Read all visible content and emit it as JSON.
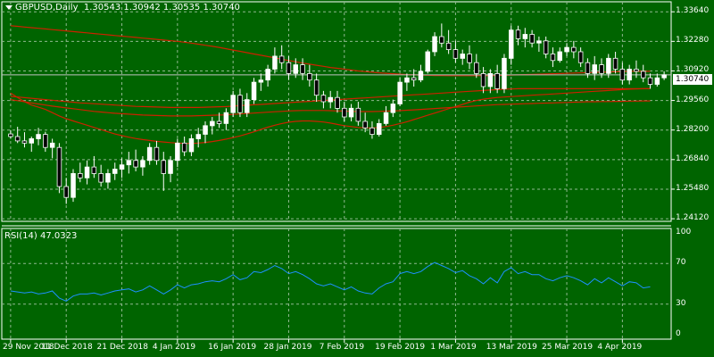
{
  "header": {
    "symbol_label": "GBPUSD,Daily",
    "ohlc": "1.30543 1.30942 1.30535 1.30740"
  },
  "price_axis": {
    "labels": [
      "1.33640",
      "1.32280",
      "1.30920",
      "1.29560",
      "1.28200",
      "1.26840",
      "1.25480",
      "1.24120"
    ],
    "values": [
      1.3364,
      1.3228,
      1.3092,
      1.2956,
      1.282,
      1.2684,
      1.2548,
      1.2412
    ],
    "current_price_label": "1.30740",
    "current_price": 1.3074
  },
  "rsi": {
    "label": "RSI(14) 47.0323",
    "axis_labels": [
      "100",
      "70",
      "30",
      "0"
    ],
    "axis_values": [
      100,
      70,
      30,
      0
    ],
    "levels": [
      70,
      30
    ]
  },
  "time_axis": {
    "labels": [
      "29 Nov 2018",
      "11 Dec 2018",
      "21 Dec 2018",
      "4 Jan 2019",
      "16 Jan 2019",
      "28 Jan 2019",
      "7 Feb 2019",
      "19 Feb 2019",
      "1 Mar 2019",
      "13 Mar 2019",
      "25 Mar 2019",
      "4 Apr 2019"
    ],
    "bar_index": [
      0,
      8,
      16,
      24,
      32,
      40,
      48,
      56,
      64,
      72,
      80,
      88
    ]
  },
  "colors": {
    "background": "#006400",
    "grid": "#8fb88f",
    "candle_up": "#ffffff",
    "candle_down": "#000000",
    "wick": "#ffffff",
    "ma": "#cc2200",
    "rsi_line": "#1e90ff"
  },
  "chart_data": {
    "type": "candlestick",
    "candles": [
      [
        1.2802,
        1.282,
        1.278,
        1.279
      ],
      [
        1.279,
        1.2835,
        1.276,
        1.277
      ],
      [
        1.277,
        1.281,
        1.274,
        1.276
      ],
      [
        1.276,
        1.279,
        1.272,
        1.278
      ],
      [
        1.278,
        1.283,
        1.275,
        1.28
      ],
      [
        1.28,
        1.2812,
        1.272,
        1.274
      ],
      [
        1.274,
        1.278,
        1.269,
        1.276
      ],
      [
        1.274,
        1.276,
        1.253,
        1.256
      ],
      [
        1.256,
        1.26,
        1.248,
        1.251
      ],
      [
        1.251,
        1.264,
        1.249,
        1.262
      ],
      [
        1.262,
        1.267,
        1.258,
        1.26
      ],
      [
        1.26,
        1.268,
        1.257,
        1.265
      ],
      [
        1.265,
        1.27,
        1.26,
        1.262
      ],
      [
        1.262,
        1.266,
        1.256,
        1.258
      ],
      [
        1.258,
        1.264,
        1.255,
        1.262
      ],
      [
        1.262,
        1.267,
        1.259,
        1.264
      ],
      [
        1.264,
        1.269,
        1.26,
        1.266
      ],
      [
        1.266,
        1.272,
        1.262,
        1.268
      ],
      [
        1.268,
        1.273,
        1.263,
        1.265
      ],
      [
        1.265,
        1.27,
        1.261,
        1.268
      ],
      [
        1.268,
        1.276,
        1.266,
        1.274
      ],
      [
        1.274,
        1.277,
        1.266,
        1.268
      ],
      [
        1.268,
        1.272,
        1.254,
        1.262
      ],
      [
        1.262,
        1.27,
        1.258,
        1.268
      ],
      [
        1.268,
        1.278,
        1.265,
        1.276
      ],
      [
        1.276,
        1.279,
        1.27,
        1.272
      ],
      [
        1.272,
        1.28,
        1.27,
        1.278
      ],
      [
        1.278,
        1.283,
        1.274,
        1.28
      ],
      [
        1.28,
        1.286,
        1.276,
        1.284
      ],
      [
        1.284,
        1.288,
        1.28,
        1.286
      ],
      [
        1.286,
        1.29,
        1.283,
        1.285
      ],
      [
        1.285,
        1.292,
        1.282,
        1.29
      ],
      [
        1.29,
        1.3,
        1.288,
        1.298
      ],
      [
        1.298,
        1.301,
        1.288,
        1.29
      ],
      [
        1.29,
        1.299,
        1.288,
        1.296
      ],
      [
        1.296,
        1.306,
        1.294,
        1.304
      ],
      [
        1.304,
        1.308,
        1.3,
        1.305
      ],
      [
        1.305,
        1.312,
        1.302,
        1.31
      ],
      [
        1.31,
        1.32,
        1.308,
        1.316
      ],
      [
        1.316,
        1.321,
        1.31,
        1.313
      ],
      [
        1.313,
        1.316,
        1.305,
        1.308
      ],
      [
        1.308,
        1.315,
        1.306,
        1.312
      ],
      [
        1.312,
        1.315,
        1.305,
        1.308
      ],
      [
        1.308,
        1.312,
        1.302,
        1.305
      ],
      [
        1.305,
        1.308,
        1.295,
        1.298
      ],
      [
        1.298,
        1.3,
        1.292,
        1.295
      ],
      [
        1.295,
        1.3,
        1.292,
        1.297
      ],
      [
        1.297,
        1.3,
        1.29,
        1.292
      ],
      [
        1.292,
        1.295,
        1.286,
        1.288
      ],
      [
        1.288,
        1.294,
        1.286,
        1.292
      ],
      [
        1.292,
        1.295,
        1.284,
        1.286
      ],
      [
        1.286,
        1.29,
        1.281,
        1.283
      ],
      [
        1.283,
        1.286,
        1.278,
        1.28
      ],
      [
        1.28,
        1.287,
        1.279,
        1.285
      ],
      [
        1.285,
        1.293,
        1.284,
        1.29
      ],
      [
        1.29,
        1.296,
        1.288,
        1.294
      ],
      [
        1.294,
        1.306,
        1.293,
        1.304
      ],
      [
        1.304,
        1.308,
        1.3,
        1.306
      ],
      [
        1.306,
        1.31,
        1.302,
        1.305
      ],
      [
        1.305,
        1.312,
        1.304,
        1.309
      ],
      [
        1.309,
        1.319,
        1.308,
        1.318
      ],
      [
        1.318,
        1.327,
        1.316,
        1.325
      ],
      [
        1.325,
        1.331,
        1.32,
        1.322
      ],
      [
        1.322,
        1.328,
        1.317,
        1.319
      ],
      [
        1.319,
        1.323,
        1.313,
        1.315
      ],
      [
        1.315,
        1.319,
        1.312,
        1.317
      ],
      [
        1.317,
        1.321,
        1.31,
        1.313
      ],
      [
        1.313,
        1.317,
        1.306,
        1.308
      ],
      [
        1.308,
        1.311,
        1.299,
        1.302
      ],
      [
        1.302,
        1.31,
        1.299,
        1.308
      ],
      [
        1.308,
        1.312,
        1.299,
        1.301
      ],
      [
        1.301,
        1.317,
        1.299,
        1.315
      ],
      [
        1.315,
        1.33,
        1.312,
        1.328
      ],
      [
        1.328,
        1.33,
        1.321,
        1.324
      ],
      [
        1.324,
        1.329,
        1.32,
        1.326
      ],
      [
        1.326,
        1.328,
        1.32,
        1.322
      ],
      [
        1.322,
        1.325,
        1.318,
        1.323
      ],
      [
        1.323,
        1.325,
        1.315,
        1.317
      ],
      [
        1.317,
        1.32,
        1.311,
        1.314
      ],
      [
        1.314,
        1.32,
        1.313,
        1.318
      ],
      [
        1.318,
        1.322,
        1.316,
        1.32
      ],
      [
        1.32,
        1.323,
        1.315,
        1.318
      ],
      [
        1.318,
        1.32,
        1.311,
        1.313
      ],
      [
        1.313,
        1.315,
        1.306,
        1.308
      ],
      [
        1.308,
        1.316,
        1.305,
        1.312
      ],
      [
        1.312,
        1.315,
        1.306,
        1.308
      ],
      [
        1.308,
        1.317,
        1.306,
        1.315
      ],
      [
        1.315,
        1.318,
        1.308,
        1.31
      ],
      [
        1.31,
        1.313,
        1.303,
        1.305
      ],
      [
        1.305,
        1.312,
        1.303,
        1.31
      ],
      [
        1.31,
        1.314,
        1.306,
        1.309
      ],
      [
        1.309,
        1.312,
        1.304,
        1.306
      ],
      [
        1.306,
        1.308,
        1.301,
        1.303
      ],
      [
        1.303,
        1.308,
        1.302,
        1.306
      ],
      [
        1.306,
        1.309,
        1.305,
        1.3074
      ]
    ],
    "ma_series": [
      {
        "values": [
          1.33,
          1.3297,
          1.3294,
          1.3291,
          1.3288,
          1.3285,
          1.3282,
          1.3279,
          1.3276,
          1.3273,
          1.327,
          1.3267,
          1.3264,
          1.3261,
          1.3258,
          1.3255,
          1.3252,
          1.3249,
          1.3246,
          1.3243,
          1.324,
          1.3237,
          1.3234,
          1.3231,
          1.3228,
          1.3224,
          1.322,
          1.3215,
          1.321,
          1.3205,
          1.32,
          1.3194,
          1.3188,
          1.3182,
          1.3176,
          1.317,
          1.3164,
          1.3158,
          1.3152,
          1.3146,
          1.314,
          1.3134,
          1.3128,
          1.3123,
          1.3118,
          1.3113,
          1.3108,
          1.3104,
          1.31,
          1.3096,
          1.3092,
          1.3089,
          1.3086,
          1.3083,
          1.3081,
          1.3079,
          1.3077,
          1.3075,
          1.3074,
          1.3073,
          1.3072,
          1.3071,
          1.3071,
          1.307,
          1.307,
          1.307,
          1.307,
          1.307,
          1.307,
          1.307,
          1.3071,
          1.3072,
          1.3073,
          1.3074,
          1.3075,
          1.3076,
          1.3077,
          1.3078,
          1.3079,
          1.308,
          1.3081,
          1.3082,
          1.3083,
          1.3084,
          1.3085,
          1.3086,
          1.3087,
          1.3088,
          1.3089,
          1.309,
          1.309,
          1.309,
          1.309
        ]
      },
      {
        "values": [
          1.2975,
          1.2972,
          1.2969,
          1.2966,
          1.2963,
          1.296,
          1.2957,
          1.2954,
          1.2951,
          1.2948,
          1.2945,
          1.2943,
          1.2941,
          1.2939,
          1.2937,
          1.2935,
          1.2933,
          1.2931,
          1.2929,
          1.2928,
          1.2927,
          1.2926,
          1.2925,
          1.2924,
          1.2924,
          1.2924,
          1.2924,
          1.2924,
          1.2925,
          1.2926,
          1.2927,
          1.2928,
          1.293,
          1.2932,
          1.2934,
          1.2936,
          1.2938,
          1.294,
          1.2942,
          1.2944,
          1.2946,
          1.2948,
          1.295,
          1.2952,
          1.2954,
          1.2956,
          1.2958,
          1.296,
          1.2962,
          1.2964,
          1.2966,
          1.2968,
          1.297,
          1.2972,
          1.2974,
          1.2976,
          1.2978,
          1.298,
          1.2982,
          1.2984,
          1.2986,
          1.2988,
          1.299,
          1.2992,
          1.2994,
          1.2996,
          1.2998,
          1.3,
          1.3002,
          1.3004,
          1.3006,
          1.3008,
          1.3009,
          1.301,
          1.301,
          1.301,
          1.301,
          1.301,
          1.301,
          1.301,
          1.301,
          1.301,
          1.301,
          1.301,
          1.301,
          1.301,
          1.301,
          1.301,
          1.301,
          1.301,
          1.301,
          1.301,
          1.301
        ]
      },
      {
        "values": [
          1.299,
          1.297,
          1.295,
          1.2935,
          1.2925,
          1.2915,
          1.29,
          1.2885,
          1.2872,
          1.2862,
          1.2852,
          1.2842,
          1.2832,
          1.2822,
          1.2812,
          1.2802,
          1.2794,
          1.2787,
          1.2781,
          1.2776,
          1.2772,
          1.2768,
          1.2765,
          1.2762,
          1.276,
          1.2759,
          1.2758,
          1.276,
          1.2763,
          1.2767,
          1.2772,
          1.2778,
          1.2785,
          1.2793,
          1.2802,
          1.2812,
          1.2823,
          1.2833,
          1.2842,
          1.285,
          1.2856,
          1.286,
          1.2862,
          1.2862,
          1.286,
          1.2857,
          1.2852,
          1.2846,
          1.284,
          1.2836,
          1.2832,
          1.283,
          1.283,
          1.2832,
          1.2836,
          1.2842,
          1.285,
          1.2858,
          1.2868,
          1.2878,
          1.2888,
          1.2898,
          1.2908,
          1.2918,
          1.2928,
          1.2938,
          1.2948,
          1.2956,
          1.2962,
          1.2966,
          1.297,
          1.2972,
          1.2974,
          1.2976,
          1.2978,
          1.298,
          1.2982,
          1.2984,
          1.2986,
          1.2988,
          1.299,
          1.2992,
          1.2994,
          1.2996,
          1.2998,
          1.3,
          1.3002,
          1.3004,
          1.3006,
          1.3008,
          1.3009,
          1.301,
          1.301
        ]
      },
      {
        "values": [
          1.296,
          1.2955,
          1.295,
          1.2945,
          1.294,
          1.2935,
          1.293,
          1.2926,
          1.2922,
          1.2918,
          1.2914,
          1.291,
          1.2906,
          1.2903,
          1.29,
          1.2897,
          1.2895,
          1.2893,
          1.2891,
          1.2889,
          1.2888,
          1.2887,
          1.2886,
          1.2885,
          1.2885,
          1.2885,
          1.2885,
          1.2886,
          1.2887,
          1.2888,
          1.2889,
          1.289,
          1.2892,
          1.2894,
          1.2896,
          1.2898,
          1.29,
          1.2902,
          1.2904,
          1.2906,
          1.2908,
          1.2909,
          1.291,
          1.291,
          1.291,
          1.291,
          1.2909,
          1.2908,
          1.2907,
          1.2906,
          1.2905,
          1.2905,
          1.2905,
          1.2906,
          1.2907,
          1.2908,
          1.2909,
          1.2911,
          1.2913,
          1.2915,
          1.2917,
          1.2919,
          1.2921,
          1.2923,
          1.2925,
          1.2927,
          1.2929,
          1.2931,
          1.2933,
          1.2935,
          1.2937,
          1.2938,
          1.2939,
          1.294,
          1.2941,
          1.2942,
          1.2943,
          1.2944,
          1.2945,
          1.2946,
          1.2947,
          1.2948,
          1.2949,
          1.295,
          1.295,
          1.2951,
          1.2951,
          1.2952,
          1.2952,
          1.2953,
          1.2953,
          1.2954,
          1.2954
        ]
      }
    ],
    "rsi_values": [
      43,
      42,
      41,
      42,
      40,
      41,
      43,
      36,
      33,
      38,
      40,
      40,
      41,
      39,
      41,
      43,
      44,
      45,
      42,
      44,
      48,
      44,
      40,
      44,
      49,
      46,
      49,
      50,
      52,
      53,
      52,
      55,
      59,
      54,
      56,
      62,
      61,
      64,
      68,
      65,
      60,
      62,
      59,
      55,
      50,
      48,
      50,
      47,
      44,
      47,
      43,
      41,
      40,
      46,
      50,
      52,
      60,
      62,
      60,
      62,
      67,
      71,
      68,
      65,
      61,
      63,
      58,
      55,
      50,
      56,
      51,
      62,
      66,
      60,
      62,
      59,
      59,
      55,
      53,
      56,
      58,
      56,
      53,
      49,
      55,
      51,
      56,
      52,
      48,
      52,
      51,
      46,
      47
    ],
    "ylim": [
      1.24,
      1.341
    ],
    "rsi_ylim": [
      0,
      100
    ],
    "grid": true
  }
}
